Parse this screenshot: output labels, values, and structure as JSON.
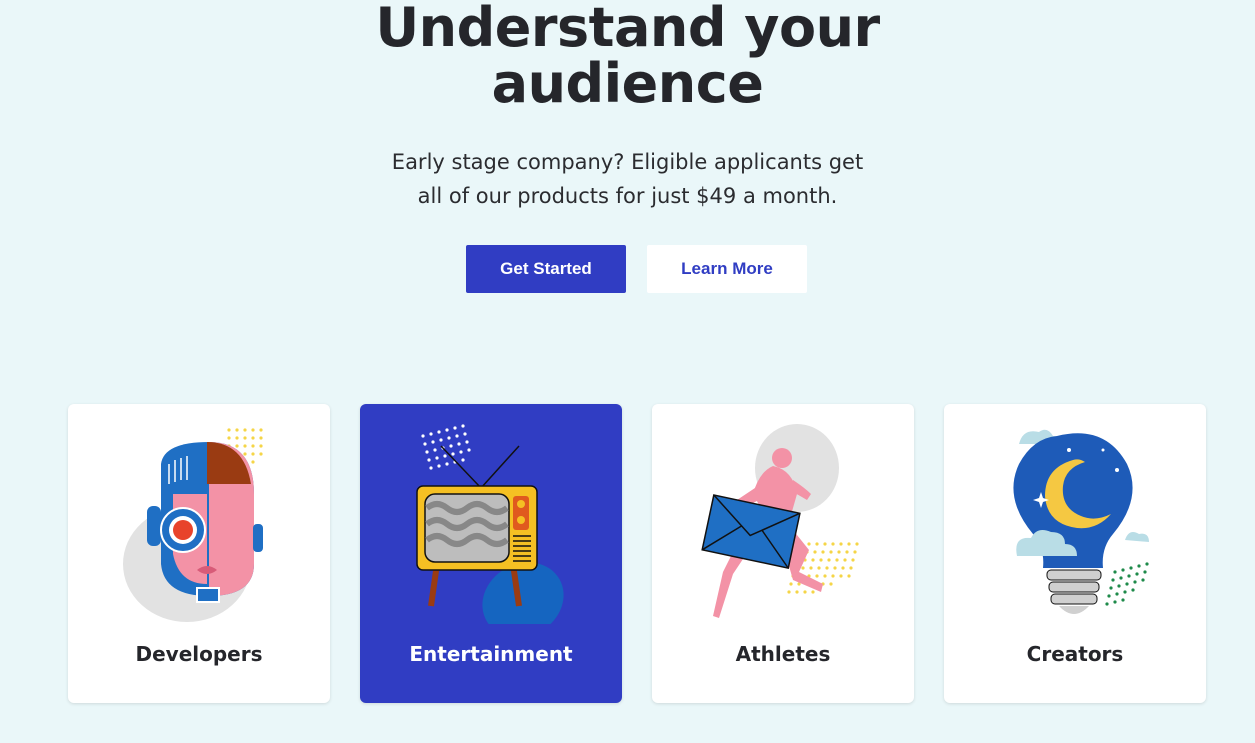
{
  "hero": {
    "title_line1": "Understand your",
    "title_line2": "audience",
    "subtitle_line1": "Early stage company? Eligible applicants get",
    "subtitle_line2": "all of our products for just $49 a month."
  },
  "buttons": {
    "primary_label": "Get Started",
    "secondary_label": "Learn More"
  },
  "cards": [
    {
      "label": "Developers",
      "icon": "developer-robot-face-icon",
      "selected": false
    },
    {
      "label": "Entertainment",
      "icon": "retro-tv-icon",
      "selected": true
    },
    {
      "label": "Athletes",
      "icon": "running-athlete-icon",
      "selected": false
    },
    {
      "label": "Creators",
      "icon": "lightbulb-moon-icon",
      "selected": false
    }
  ],
  "colors": {
    "background": "#eaf7f9",
    "accent": "#303dc3",
    "text": "#25262b"
  }
}
